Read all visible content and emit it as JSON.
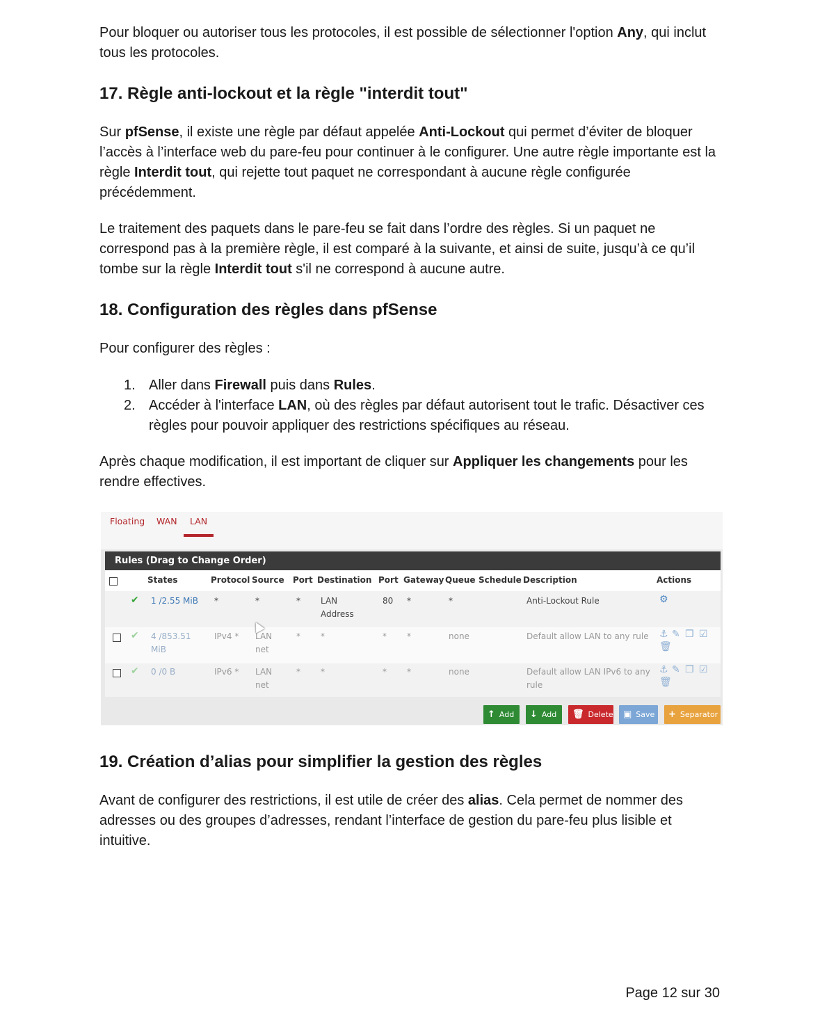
{
  "intro": {
    "pre": "Pour bloquer ou autoriser tous les protocoles, il est possible de sélectionner l'option ",
    "bold": "Any",
    "post": ", qui inclut tous les protocoles."
  },
  "section17": {
    "heading": "17. Règle anti-lockout et la règle \"interdit tout\"",
    "p1_a": "Sur ",
    "p1_b": "pfSense",
    "p1_c": ", il existe une règle par défaut appelée ",
    "p1_d": "Anti-Lockout",
    "p1_e": " qui permet d’éviter de bloquer l’accès à l’interface web du pare-feu pour continuer à le configurer. Une autre règle importante est la règle ",
    "p1_f": "Interdit tout",
    "p1_g": ", qui rejette tout paquet ne correspondant à aucune règle configurée précédemment.",
    "p2_a": "Le traitement des paquets dans le pare-feu se fait dans l’ordre des règles. Si un paquet ne correspond pas à la première règle, il est comparé à la suivante, et ainsi de suite, jusqu’à ce qu’il tombe sur la règle ",
    "p2_b": "Interdit tout",
    "p2_c": " s'il ne correspond à aucune autre."
  },
  "section18": {
    "heading": "18. Configuration des règles dans pfSense",
    "intro": "Pour configurer des règles :",
    "item1_num": "1.",
    "item1_a": "Aller dans ",
    "item1_b": "Firewall",
    "item1_c": " puis dans ",
    "item1_d": "Rules",
    "item1_e": ".",
    "item2_num": "2.",
    "item2_a": "Accéder à l'interface ",
    "item2_b": "LAN",
    "item2_c": ", où des règles par défaut autorisent tout le trafic. Désactiver ces règles pour pouvoir appliquer des restrictions spécifiques au réseau.",
    "after_a": "Après chaque modification, il est important de cliquer sur ",
    "after_b": "Appliquer les changements",
    "after_c": " pour les rendre effectives."
  },
  "screenshot": {
    "tabs": [
      "Floating",
      "WAN",
      "LAN"
    ],
    "panel_title": "Rules (Drag to Change Order)",
    "headers": [
      "States",
      "Protocol",
      "Source",
      "Port",
      "Destination",
      "Port",
      "Gateway",
      "Queue",
      "Schedule",
      "Description",
      "Actions"
    ],
    "rows": [
      {
        "states": "1 /2.55 MiB",
        "protocol": "*",
        "source": "*",
        "port": "*",
        "destination": "LAN",
        "destination2": "Address",
        "dport": "80",
        "gateway": "*",
        "queue": "*",
        "schedule": "",
        "description": "Anti-Lockout Rule"
      },
      {
        "states": "4 /853.51",
        "states2": "MiB",
        "protocol": "IPv4 *",
        "source": "LAN",
        "source2": "net",
        "port": "*",
        "destination": "*",
        "dport": "*",
        "gateway": "*",
        "queue": "none",
        "schedule": "",
        "description": "Default allow LAN to any rule"
      },
      {
        "states": "0 /0 B",
        "protocol": "IPv6 *",
        "source": "LAN",
        "source2": "net",
        "port": "*",
        "destination": "*",
        "dport": "*",
        "gateway": "*",
        "queue": "none",
        "schedule": "",
        "description": "Default allow LAN IPv6 to any",
        "description2": "rule"
      }
    ],
    "buttons": {
      "add_top": "Add",
      "add_bottom": "Add",
      "delete": "Delete",
      "save": "Save",
      "separator": "Separator"
    },
    "colors": {
      "tab_active": "#b3262b",
      "add": "#2e8b34",
      "delete": "#c9282d",
      "save": "#7ba6d6",
      "separator": "#e8a23e"
    }
  },
  "section19": {
    "heading": "19. Création d’alias pour simplifier la gestion des règles",
    "p_a": "Avant de configurer des restrictions, il est utile de créer des ",
    "p_b": "alias",
    "p_c": ". Cela permet de nommer des adresses ou des groupes d’adresses, rendant l’interface de gestion du pare-feu plus lisible et intuitive."
  },
  "footer": {
    "page": "Page 12 sur 30"
  }
}
